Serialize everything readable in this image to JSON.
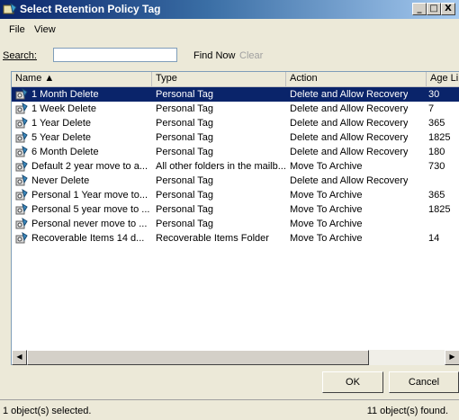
{
  "window": {
    "title": "Select Retention Policy Tag",
    "minimize": "_",
    "maximize": "□",
    "close": "X"
  },
  "menu": {
    "file": "File",
    "view": "View"
  },
  "search": {
    "label": "Search:",
    "value": "",
    "find_now": "Find Now",
    "clear": "Clear"
  },
  "list": {
    "columns": [
      "Name ▲",
      "Type",
      "Action",
      "Age Lir"
    ],
    "rows": [
      {
        "name": "1 Month Delete",
        "type": "Personal Tag",
        "action": "Delete and Allow Recovery",
        "age": "30",
        "selected": true
      },
      {
        "name": "1 Week Delete",
        "type": "Personal Tag",
        "action": "Delete and Allow Recovery",
        "age": "7"
      },
      {
        "name": "1 Year Delete",
        "type": "Personal Tag",
        "action": "Delete and Allow Recovery",
        "age": "365"
      },
      {
        "name": "5 Year Delete",
        "type": "Personal Tag",
        "action": "Delete and Allow Recovery",
        "age": "1825"
      },
      {
        "name": "6 Month Delete",
        "type": "Personal Tag",
        "action": "Delete and Allow Recovery",
        "age": "180"
      },
      {
        "name": "Default 2 year move to a...",
        "type": "All other folders in the mailb...",
        "action": "Move To Archive",
        "age": "730"
      },
      {
        "name": "Never Delete",
        "type": "Personal Tag",
        "action": "Delete and Allow Recovery",
        "age": ""
      },
      {
        "name": "Personal 1 Year move to...",
        "type": "Personal Tag",
        "action": "Move To Archive",
        "age": "365"
      },
      {
        "name": "Personal 5 year move to ...",
        "type": "Personal Tag",
        "action": "Move To Archive",
        "age": "1825"
      },
      {
        "name": "Personal never move to ...",
        "type": "Personal Tag",
        "action": "Move To Archive",
        "age": ""
      },
      {
        "name": "Recoverable Items 14 d...",
        "type": "Recoverable Items Folder",
        "action": "Move To Archive",
        "age": "14"
      }
    ]
  },
  "buttons": {
    "ok": "OK",
    "cancel": "Cancel"
  },
  "status": {
    "left": "1 object(s) selected.",
    "right": "11 object(s) found."
  },
  "colors": {
    "title_start": "#0a246a",
    "selection": "#0a246a",
    "face": "#ece9d8"
  }
}
